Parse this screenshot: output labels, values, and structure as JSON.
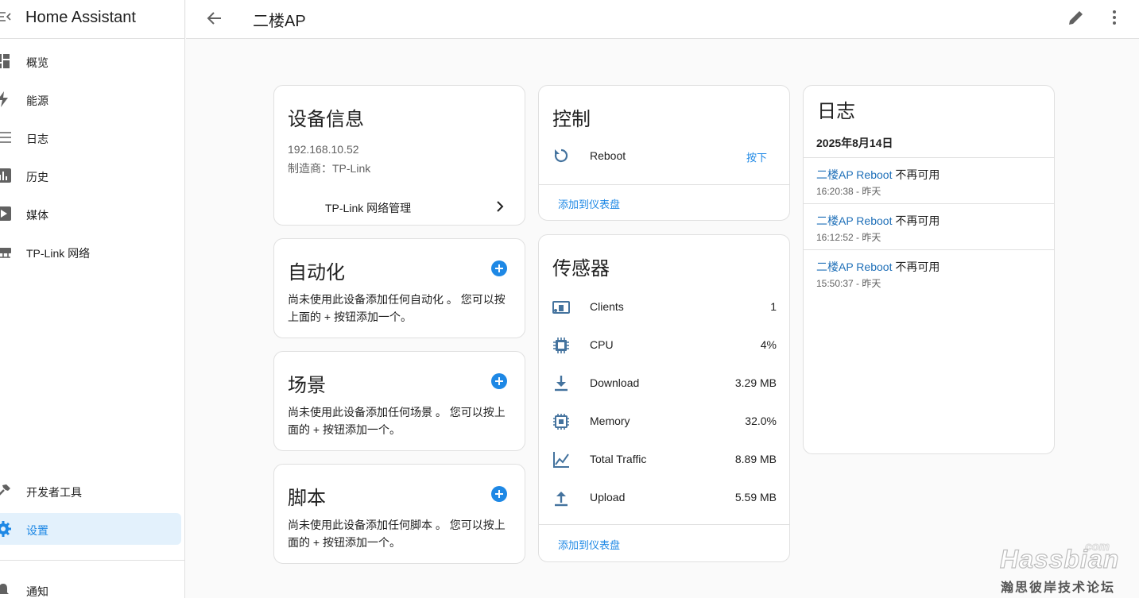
{
  "app": {
    "title": "Home Assistant"
  },
  "sidebar": {
    "items": [
      {
        "label": "概览",
        "icon": "dashboard-icon"
      },
      {
        "label": "能源",
        "icon": "lightning-icon"
      },
      {
        "label": "日志",
        "icon": "list-icon"
      },
      {
        "label": "历史",
        "icon": "chart-bar-icon"
      },
      {
        "label": "媒体",
        "icon": "play-box-icon"
      },
      {
        "label": "TP-Link 网络",
        "icon": "network-icon"
      }
    ],
    "bottom_items": [
      {
        "label": "开发者工具",
        "icon": "hammer-icon"
      },
      {
        "label": "设置",
        "icon": "gear-icon",
        "active": true
      }
    ],
    "notifications": {
      "label": "通知",
      "icon": "bell-icon"
    }
  },
  "header": {
    "title": "二楼AP"
  },
  "device_info": {
    "title": "设备信息",
    "ip": "192.168.10.52",
    "manufacturer": "制造商：TP-Link",
    "integration_link": "TP-Link 网络管理"
  },
  "automation": {
    "title": "自动化",
    "description": "尚未使用此设备添加任何自动化 。 您可以按上面的 + 按钮添加一个。"
  },
  "scene": {
    "title": "场景",
    "description": "尚未使用此设备添加任何场景 。 您可以按上面的 + 按钮添加一个。"
  },
  "script": {
    "title": "脚本",
    "description": "尚未使用此设备添加任何脚本 。 您可以按上面的 + 按钮添加一个。"
  },
  "controls": {
    "title": "控制",
    "items": [
      {
        "label": "Reboot",
        "action": "按下",
        "icon": "restart-icon"
      }
    ],
    "add_to_dashboard": "添加到仪表盘"
  },
  "sensors": {
    "title": "传感器",
    "items": [
      {
        "label": "Clients",
        "value": "1",
        "icon": "devices-icon"
      },
      {
        "label": "CPU",
        "value": "4%",
        "icon": "cpu-icon"
      },
      {
        "label": "Download",
        "value": "3.29 MB",
        "icon": "download-icon"
      },
      {
        "label": "Memory",
        "value": "32.0%",
        "icon": "memory-icon"
      },
      {
        "label": "Total Traffic",
        "value": "8.89 MB",
        "icon": "line-chart-icon"
      },
      {
        "label": "Upload",
        "value": "5.59 MB",
        "icon": "upload-icon"
      }
    ],
    "add_to_dashboard": "添加到仪表盘"
  },
  "logbook": {
    "title": "日志",
    "date": "2025年8月14日",
    "entries": [
      {
        "entity": "二楼AP Reboot",
        "message": " 不再可用",
        "time": "16:20:38 - 昨天"
      },
      {
        "entity": "二楼AP Reboot",
        "message": " 不再可用",
        "time": "16:12:52 - 昨天"
      },
      {
        "entity": "二楼AP Reboot",
        "message": " 不再可用",
        "time": "15:50:37 - 昨天"
      }
    ]
  },
  "watermark": {
    "com": "com",
    "main": "Hassbian",
    "sub": "瀚思彼岸技术论坛"
  },
  "colors": {
    "accent": "#1e88e5",
    "active_bg": "#e3f1fc",
    "icon": "#44739e"
  }
}
